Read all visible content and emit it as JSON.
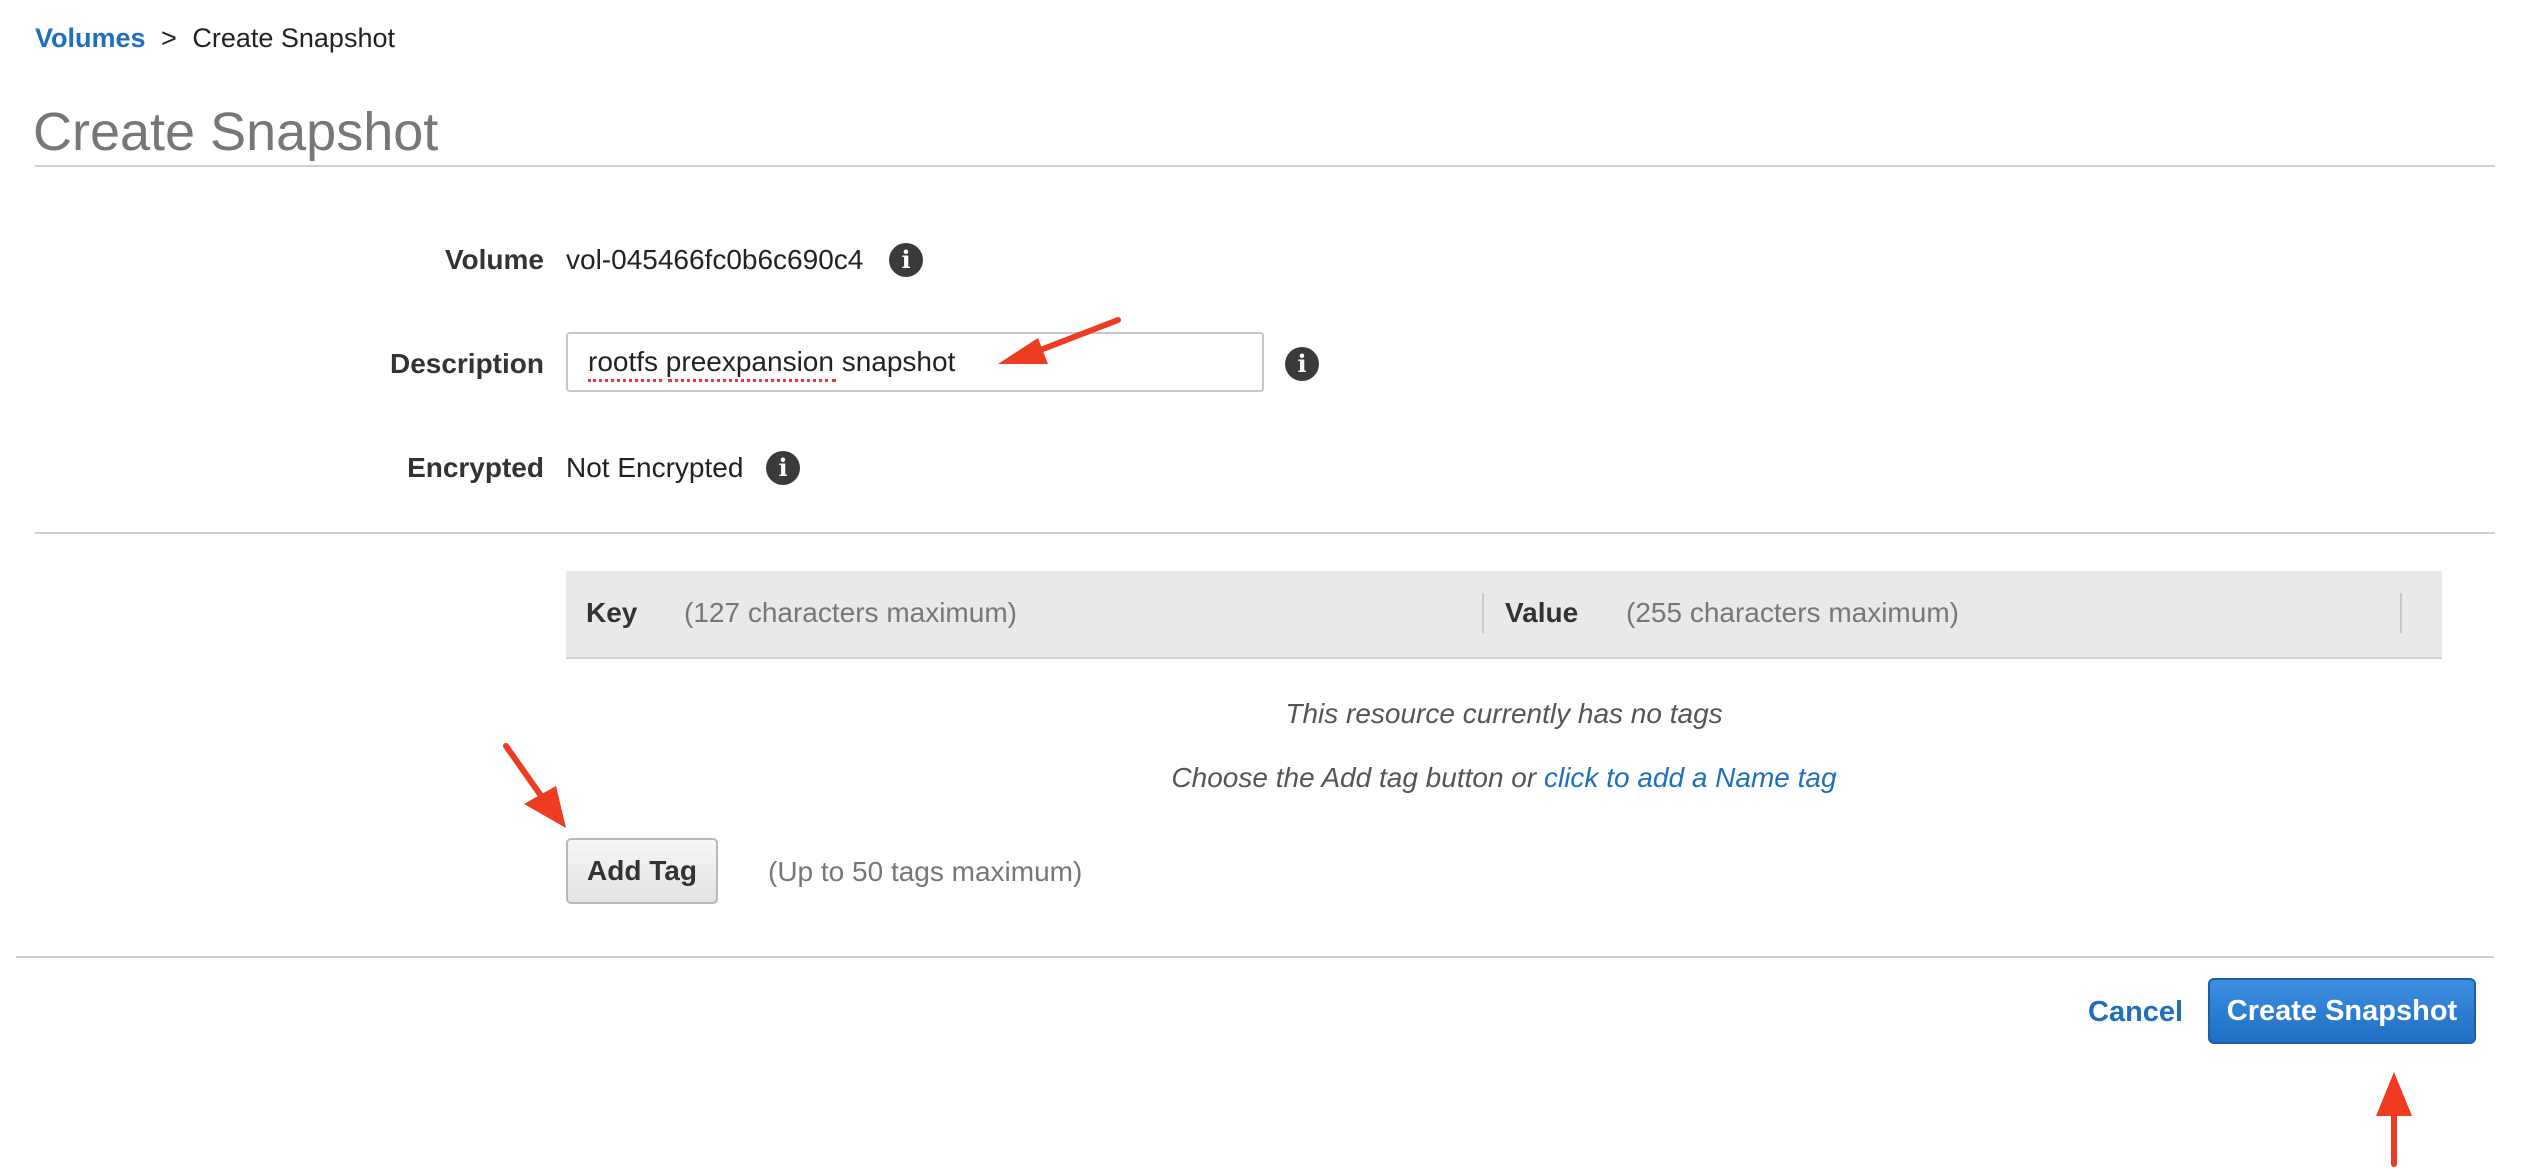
{
  "breadcrumb": {
    "parent": "Volumes",
    "separator": ">",
    "current": "Create Snapshot"
  },
  "page": {
    "title": "Create Snapshot"
  },
  "form": {
    "volume_label": "Volume",
    "volume_value": "vol-045466fc0b6c690c4",
    "description_label": "Description",
    "description_value": "rootfs preexpansion snapshot",
    "encrypted_label": "Encrypted",
    "encrypted_value": "Not Encrypted"
  },
  "tags": {
    "key_header": "Key",
    "key_hint": "(127 characters maximum)",
    "value_header": "Value",
    "value_hint": "(255 characters maximum)",
    "empty_message": "This resource currently has no tags",
    "choose_prefix": "Choose the Add tag button or",
    "name_tag_link": "click to add a Name tag",
    "add_tag_label": "Add Tag",
    "limit_note": "(Up to 50 tags maximum)"
  },
  "actions": {
    "cancel_label": "Cancel",
    "create_label": "Create Snapshot"
  },
  "icons": {
    "info": "info-icon",
    "annotation": "red-arrow"
  },
  "colors": {
    "link": "#1f6fbf",
    "primary_button": "#2a7bd1",
    "annotation_arrow": "#ee3b22",
    "title": "#777777"
  }
}
